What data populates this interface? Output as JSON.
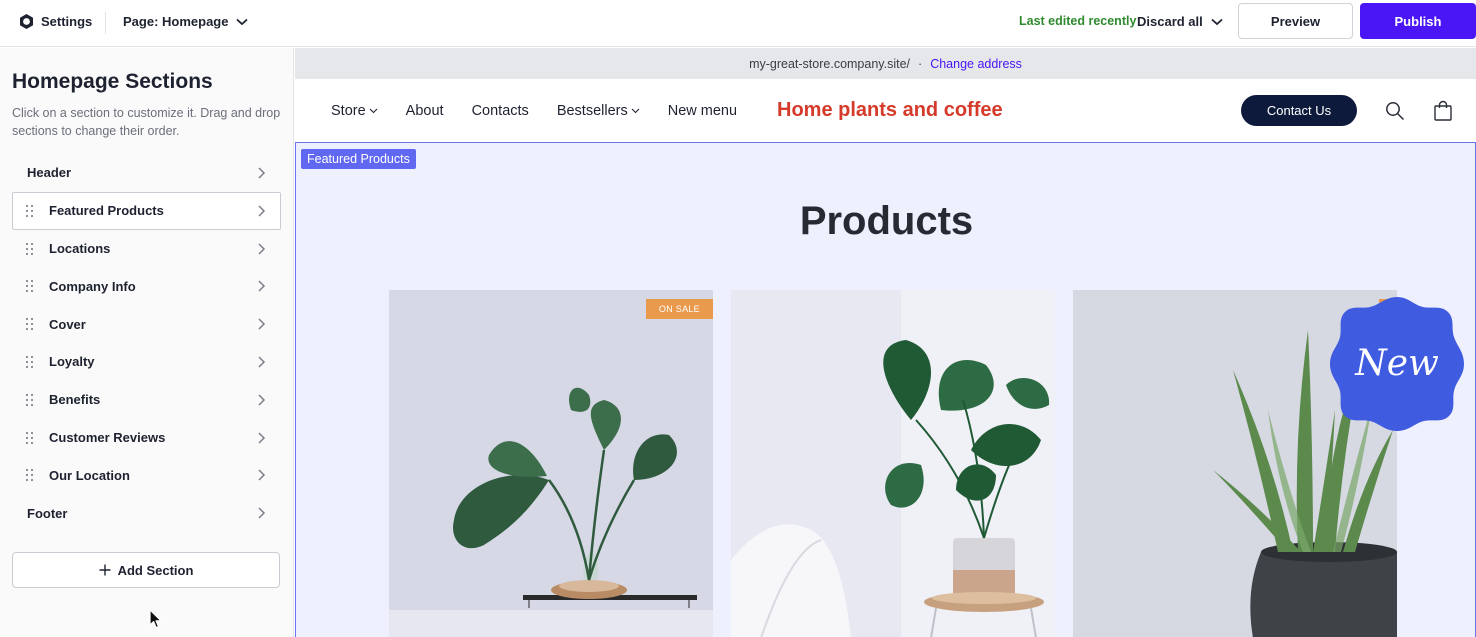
{
  "topbar": {
    "settings_label": "Settings",
    "page_label": "Page: Homepage",
    "last_edited": "Last edited recently",
    "discard_label": "Discard all",
    "preview_label": "Preview",
    "publish_label": "Publish"
  },
  "sidebar": {
    "title": "Homepage Sections",
    "description": "Click on a section to customize it. Drag and drop sections to change their order.",
    "items": [
      {
        "label": "Header"
      },
      {
        "label": "Featured Products"
      },
      {
        "label": "Locations"
      },
      {
        "label": "Company Info"
      },
      {
        "label": "Cover"
      },
      {
        "label": "Loyalty"
      },
      {
        "label": "Benefits"
      },
      {
        "label": "Customer Reviews"
      },
      {
        "label": "Our Location"
      },
      {
        "label": "Footer"
      }
    ],
    "add_section_label": "Add Section"
  },
  "preview": {
    "address": "my-great-store.company.site/",
    "address_separator": "·",
    "change_address_label": "Change address",
    "nav": [
      {
        "label": "Store"
      },
      {
        "label": "About"
      },
      {
        "label": "Contacts"
      },
      {
        "label": "Bestsellers"
      },
      {
        "label": "New menu"
      }
    ],
    "brand": "Home plants and coffee",
    "contact_label": "Contact Us",
    "featured_tag": "Featured Products",
    "products_title": "Products",
    "badge_new": "New",
    "sale_label": "ON SALE"
  },
  "colors": {
    "accent": "#4a16f5",
    "brand": "#d53a2a",
    "success": "#2f8a2f",
    "highlight": "#6068f2",
    "sale": "#e99a4c",
    "badge": "#3f5be0"
  },
  "icons": [
    "logo-icon",
    "chevron-down-icon",
    "drag-handle-icon",
    "chevron-right-icon",
    "plus-icon",
    "search-icon",
    "shopping-bag-icon",
    "cursor-icon"
  ]
}
